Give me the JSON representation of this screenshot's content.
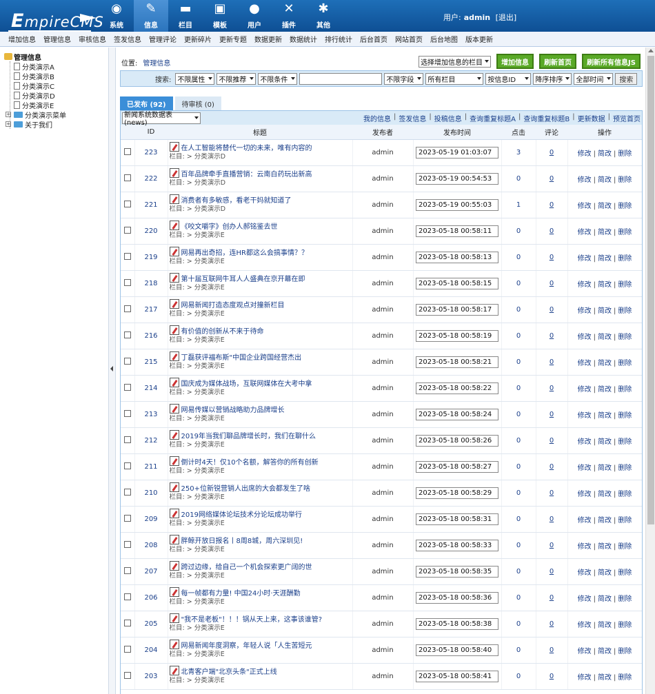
{
  "header": {
    "nav": [
      {
        "label": "系统",
        "icon": "globe-icon"
      },
      {
        "label": "信息",
        "icon": "edit-icon",
        "active": true
      },
      {
        "label": "栏目",
        "icon": "folder-icon"
      },
      {
        "label": "模板",
        "icon": "window-icon"
      },
      {
        "label": "用户",
        "icon": "user-icon"
      },
      {
        "label": "插件",
        "icon": "tools-icon"
      },
      {
        "label": "其他",
        "icon": "gear-icon"
      }
    ],
    "user_label": "用户:",
    "user_name": "admin",
    "logout": "[退出]"
  },
  "subnav": [
    "增加信息",
    "管理信息",
    "审核信息",
    "签发信息",
    "管理评论",
    "更新碎片",
    "更新专题",
    "数据更新",
    "数据统计",
    "排行统计",
    "后台首页",
    "网站首页",
    "后台地图",
    "版本更新"
  ],
  "tree": {
    "root": "管理信息",
    "children": [
      "分类演示A",
      "分类演示B",
      "分类演示C",
      "分类演示D",
      "分类演示E"
    ],
    "folders": [
      "分类演示菜单",
      "关于我们"
    ]
  },
  "location": {
    "label": "位置:",
    "link": "管理信息"
  },
  "toolbar": {
    "column_select": "选择增加信息的栏目",
    "add_btn": "增加信息",
    "refresh_home_btn": "刷新首页",
    "refresh_js_btn": "刷新所有信息JS"
  },
  "search": {
    "label": "搜索:",
    "sel1": "不限属性",
    "sel2": "不限推荐",
    "sel3": "不限条件",
    "sel4": "不限字段",
    "sel5": "所有栏目",
    "sel6": "按信息ID",
    "sel7": "降序排序",
    "sel8": "全部时间",
    "btn": "搜索"
  },
  "tabs": {
    "published": "已发布 (92)",
    "pending": "待审核 (0)"
  },
  "listhead": {
    "table_select": "新闻系统数据表(news)",
    "links": [
      "我的信息",
      "签发信息",
      "投稿信息",
      "查询重复标题A",
      "查询重复标题B",
      "更新数据",
      "预览首页"
    ]
  },
  "columns": {
    "id": "ID",
    "title": "标题",
    "publisher": "发布者",
    "time": "发布时间",
    "clicks": "点击",
    "comments": "评论",
    "actions": "操作"
  },
  "row_labels": {
    "cat_prefix": "栏目: > ",
    "edit": "修改",
    "quick_edit": "简改",
    "delete": "删除"
  },
  "rows": [
    {
      "id": "223",
      "title": "在人工智能将替代一切的未来，唯有内容的",
      "cat": "分类演示D",
      "pub": "admin",
      "time": "2023-05-19 01:03:07",
      "clicks": "3",
      "comments": "0"
    },
    {
      "id": "222",
      "title": "百年品牌牵手直播营销：云南白药玩出新高",
      "cat": "分类演示D",
      "pub": "admin",
      "time": "2023-05-19 00:54:53",
      "clicks": "0",
      "comments": "0"
    },
    {
      "id": "221",
      "title": "消费者有多敏感，看老干妈就知道了",
      "cat": "分类演示D",
      "pub": "admin",
      "time": "2023-05-19 00:55:03",
      "clicks": "1",
      "comments": "0"
    },
    {
      "id": "220",
      "title": "《咬文嚼字》创办人郝铭鉴去世",
      "cat": "分类演示E",
      "pub": "admin",
      "time": "2023-05-18 00:58:11",
      "clicks": "0",
      "comments": "0"
    },
    {
      "id": "219",
      "title": "网易再出奇招，连HR都这么会搞事情？？",
      "cat": "分类演示E",
      "pub": "admin",
      "time": "2023-05-18 00:58:13",
      "clicks": "0",
      "comments": "0"
    },
    {
      "id": "218",
      "title": "第十届互联网牛耳人人盛典在京开幕在即",
      "cat": "分类演示E",
      "pub": "admin",
      "time": "2023-05-18 00:58:15",
      "clicks": "0",
      "comments": "0"
    },
    {
      "id": "217",
      "title": "网易新闻打造态度观点对撞新栏目",
      "cat": "分类演示E",
      "pub": "admin",
      "time": "2023-05-18 00:58:17",
      "clicks": "0",
      "comments": "0"
    },
    {
      "id": "216",
      "title": "有价值的创新从不来于待命",
      "cat": "分类演示E",
      "pub": "admin",
      "time": "2023-05-18 00:58:19",
      "clicks": "0",
      "comments": "0"
    },
    {
      "id": "215",
      "title": "丁磊获评福布斯\"中国企业跨国经营杰出",
      "cat": "分类演示E",
      "pub": "admin",
      "time": "2023-05-18 00:58:21",
      "clicks": "0",
      "comments": "0"
    },
    {
      "id": "214",
      "title": "国庆成为媒体战场，互联网媒体在大考中拿",
      "cat": "分类演示E",
      "pub": "admin",
      "time": "2023-05-18 00:58:22",
      "clicks": "0",
      "comments": "0"
    },
    {
      "id": "213",
      "title": "网易传媒以营销战略助力品牌增长",
      "cat": "分类演示E",
      "pub": "admin",
      "time": "2023-05-18 00:58:24",
      "clicks": "0",
      "comments": "0"
    },
    {
      "id": "212",
      "title": "2019年当我们聊品牌增长时，我们在聊什么",
      "cat": "分类演示E",
      "pub": "admin",
      "time": "2023-05-18 00:58:26",
      "clicks": "0",
      "comments": "0"
    },
    {
      "id": "211",
      "title": "倒计时4天！仅10个名额，解答你的所有创新",
      "cat": "分类演示E",
      "pub": "admin",
      "time": "2023-05-18 00:58:27",
      "clicks": "0",
      "comments": "0"
    },
    {
      "id": "210",
      "title": "250+位新锐营销人出席的大会都发生了啥",
      "cat": "分类演示E",
      "pub": "admin",
      "time": "2023-05-18 00:58:29",
      "clicks": "0",
      "comments": "0"
    },
    {
      "id": "209",
      "title": "2019网络媒体论坛技术分论坛成功举行",
      "cat": "分类演示E",
      "pub": "admin",
      "time": "2023-05-18 00:58:31",
      "clicks": "0",
      "comments": "0"
    },
    {
      "id": "208",
      "title": "胖鲸开放日报名丨8周8城，周六深圳见!",
      "cat": "分类演示E",
      "pub": "admin",
      "time": "2023-05-18 00:58:33",
      "clicks": "0",
      "comments": "0"
    },
    {
      "id": "207",
      "title": "跨过边缘，给自己一个机会探索更广阔的世",
      "cat": "分类演示E",
      "pub": "admin",
      "time": "2023-05-18 00:58:35",
      "clicks": "0",
      "comments": "0"
    },
    {
      "id": "206",
      "title": "每一帧都有力量! 中国24小时·天涯酬勤",
      "cat": "分类演示E",
      "pub": "admin",
      "time": "2023-05-18 00:58:36",
      "clicks": "0",
      "comments": "0"
    },
    {
      "id": "205",
      "title": "\"我不是老板\"！！！锅从天上来，这事该谁管?",
      "cat": "分类演示E",
      "pub": "admin",
      "time": "2023-05-18 00:58:38",
      "clicks": "0",
      "comments": "0"
    },
    {
      "id": "204",
      "title": "网易新闻年度洞察，年轻人说「人生苦短元",
      "cat": "分类演示E",
      "pub": "admin",
      "time": "2023-05-18 00:58:40",
      "clicks": "0",
      "comments": "0"
    },
    {
      "id": "203",
      "title": "北青客户端\"北京头条\"正式上线",
      "cat": "分类演示E",
      "pub": "admin",
      "time": "2023-05-18 00:58:41",
      "clicks": "0",
      "comments": "0"
    }
  ]
}
